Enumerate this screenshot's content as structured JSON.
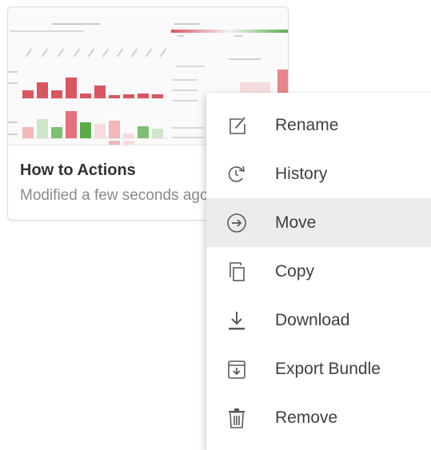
{
  "card": {
    "title": "How to Actions",
    "subtitle": "Modified a few seconds ago"
  },
  "menu": {
    "items": [
      {
        "label": "Rename",
        "icon": "edit-icon"
      },
      {
        "label": "History",
        "icon": "history-icon"
      },
      {
        "label": "Move",
        "icon": "move-icon",
        "highlighted": true
      },
      {
        "label": "Copy",
        "icon": "copy-icon"
      },
      {
        "label": "Download",
        "icon": "download-icon"
      },
      {
        "label": "Export Bundle",
        "icon": "export-bundle-icon"
      },
      {
        "label": "Remove",
        "icon": "trash-icon"
      }
    ]
  },
  "colors": {
    "bar_red": "#d9555f",
    "bar_light_red": "#f2b7b9",
    "bar_green": "#7cbf72",
    "bar_light_green": "#cfe6c8",
    "gradient_start": "#d9555f",
    "gradient_end": "#5cab4b",
    "icon": "#5a5a5a",
    "highlight": "#ececec"
  }
}
